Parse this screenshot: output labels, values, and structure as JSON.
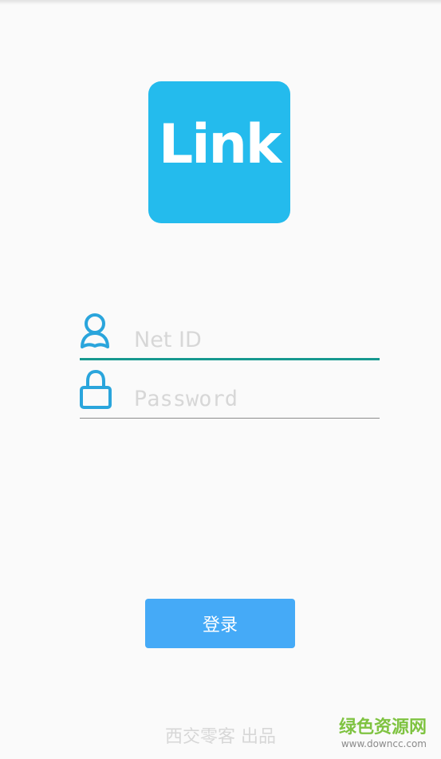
{
  "app": {
    "logo_text": "Link",
    "accent_color": "#24bbed"
  },
  "form": {
    "netid": {
      "placeholder": "Net ID",
      "value": "",
      "icon": "user-icon"
    },
    "password": {
      "placeholder": "Password",
      "value": "",
      "icon": "lock-icon"
    },
    "login_label": "登录"
  },
  "footer": {
    "credit": "西交零客 出品"
  },
  "watermark": {
    "title": "绿色资源网",
    "url": "www.downcc.com"
  },
  "colors": {
    "background": "#fafafa",
    "button": "#45aaf7",
    "active_underline": "#16988f",
    "placeholder": "#d7d7d7"
  }
}
